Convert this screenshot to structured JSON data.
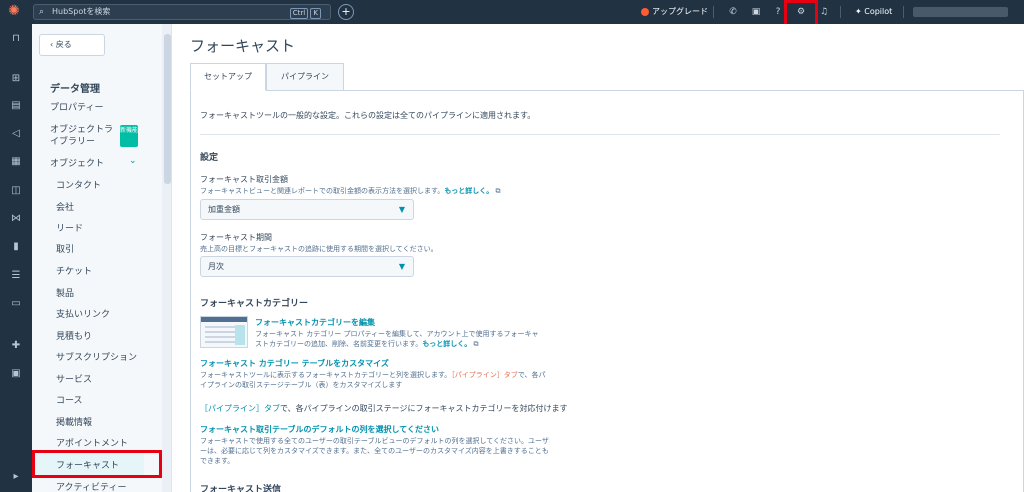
{
  "topbar": {
    "search_placeholder": "HubSpotを検索",
    "search_shortcut_ctrl": "Ctrl",
    "search_shortcut_key": "K",
    "plus": "+",
    "upgrade_label": "アップグレード",
    "copilot_label": "Copilot"
  },
  "sidebar": {
    "back_label": "戻る",
    "section_title": "データ管理",
    "items": {
      "properties": "プロパティー",
      "object_library": "オブジェクトライブラリー",
      "new_badge": "新機能",
      "objects": "オブジェクト"
    },
    "subitems": [
      "コンタクト",
      "会社",
      "リード",
      "取引",
      "チケット",
      "製品",
      "支払いリンク",
      "見積もり",
      "サブスクリプション",
      "サービス",
      "コース",
      "掲載情報",
      "アポイントメント",
      "フォーキャスト",
      "アクティビティー"
    ]
  },
  "main": {
    "title": "フォーキャスト",
    "tabs": [
      "セットアップ",
      "パイプライン"
    ],
    "intro": "フォーキャストツールの一般的な設定。これらの設定は全てのパイプラインに適用されます。",
    "settings_heading": "設定",
    "amount_label": "フォーキャスト取引金額",
    "amount_help": "フォーキャストビューと関連レポートでの取引金額の表示方法を選択します。",
    "learn_more": "もっと詳しく。",
    "amount_value": "加重金額",
    "period_label": "フォーキャスト期間",
    "period_help": "売上高の目標とフォーキャストの追跡に使用する期間を選択してください。",
    "period_value": "月次",
    "category_heading": "フォーキャストカテゴリー",
    "edit_category_link": "フォーキャストカテゴリーを編集",
    "edit_category_desc_1": "フォーキャスト カテゴリー プロパティーを編集して、アカウント上で使用するフォーキャ",
    "edit_category_desc_2": "ストカテゴリーの追加、削除、名前変更を行います。",
    "customize_table_link": "フォーキャスト カテゴリー テーブルをカスタマイズ",
    "customize_table_desc_1a": "フォーキャストツールに表示するフォーキャストカテゴリーと列を選択します。",
    "customize_table_desc_1b": "［パイプライン］タブ",
    "customize_table_desc_1c": "で、各パ",
    "customize_table_desc_2": "イプラインの取引ステージテーブル（表）をカスタマイズします",
    "pipeline_tab_note_a": "［パイプライン］タブ",
    "pipeline_tab_note_b": "で、各パイプラインの取引ステージにフォーキャストカテゴリーを対応付けます",
    "default_columns_link": "フォーキャスト取引テーブルのデフォルトの列を選択してください",
    "default_columns_desc_1": "フォーキャストで使用する全てのユーザーの取引テーブルビューのデフォルトの列を選択してください。ユーザ",
    "default_columns_desc_2": "ーは、必要に応じて列をカスタマイズできます。また、全てのユーザーのカスタマイズ内容を上書きすることも",
    "default_columns_desc_3": "できます。",
    "submission_heading": "フォーキャスト送信"
  }
}
